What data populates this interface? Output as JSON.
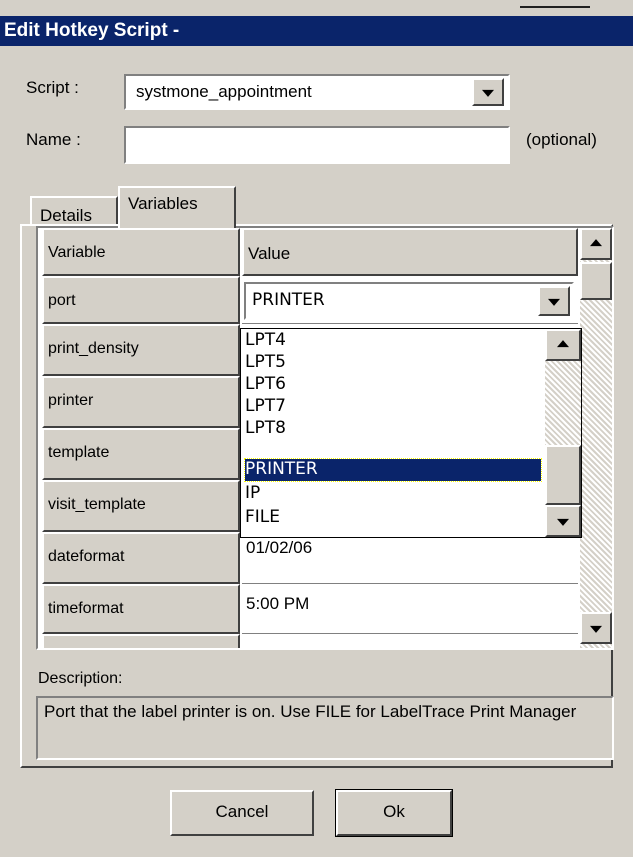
{
  "window": {
    "title": "Edit Hotkey Script -"
  },
  "script": {
    "label": "Script :",
    "value": "systmone_appointment"
  },
  "name": {
    "label": "Name :",
    "value": "",
    "optional_label": "(optional)"
  },
  "tabs": [
    {
      "label": "Details",
      "active": false
    },
    {
      "label": "Variables",
      "active": true
    }
  ],
  "grid": {
    "header_variable": "Variable",
    "header_value": "Value",
    "rows": [
      {
        "name": "port",
        "value": "PRINTER"
      },
      {
        "name": "print_density",
        "value": ""
      },
      {
        "name": "printer",
        "value": ""
      },
      {
        "name": "template",
        "value": ""
      },
      {
        "name": "visit_template",
        "value": ""
      },
      {
        "name": "dateformat",
        "value": "01/02/06"
      },
      {
        "name": "timeformat",
        "value": "5:00 PM"
      }
    ]
  },
  "dropdown": {
    "options": [
      "LPT4",
      "LPT5",
      "LPT6",
      "LPT7",
      "LPT8",
      "PRINTER",
      "IP",
      "FILE"
    ],
    "selected": "PRINTER"
  },
  "description": {
    "label": "Description:",
    "text": "Port that the label printer is on. Use FILE for LabelTrace Print Manager"
  },
  "buttons": {
    "cancel": "Cancel",
    "ok": "Ok"
  },
  "colors": {
    "titlebar": "#0a246a",
    "face": "#d4d0c8",
    "selection": "#0a246a"
  }
}
